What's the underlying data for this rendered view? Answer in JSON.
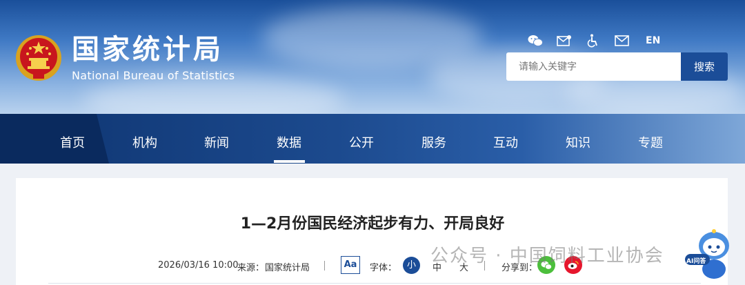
{
  "header": {
    "title_cn": "国家统计局",
    "title_en": "National Bureau of Statistics",
    "lang_label": "EN",
    "icons": [
      "wechat-icon",
      "mail-icon",
      "accessibility-icon",
      "envelope-icon"
    ]
  },
  "search": {
    "placeholder": "请输入关键字",
    "button_label": "搜索"
  },
  "nav": {
    "items": [
      "首页",
      "机构",
      "新闻",
      "数据",
      "公开",
      "服务",
      "互动",
      "知识",
      "专题"
    ],
    "active": "数据"
  },
  "article": {
    "title": "1—2月份国民经济起步有力、开局良好",
    "date": "2026/03/16 10:00",
    "source_label": "来源：",
    "source": "国家统计局",
    "aa_label": "Aa",
    "font_label": "字体：",
    "font_sizes": [
      "小",
      "中",
      "大"
    ],
    "share_label": "分享到："
  },
  "overlay": {
    "watermark": "公众号 · 中国饲料工业协会",
    "ai_label": "AI问答"
  },
  "colors": {
    "primary": "#1b4d98",
    "nav_dark": "#0e3470",
    "wechat": "#4cbf3c",
    "weibo": "#e6162d"
  }
}
